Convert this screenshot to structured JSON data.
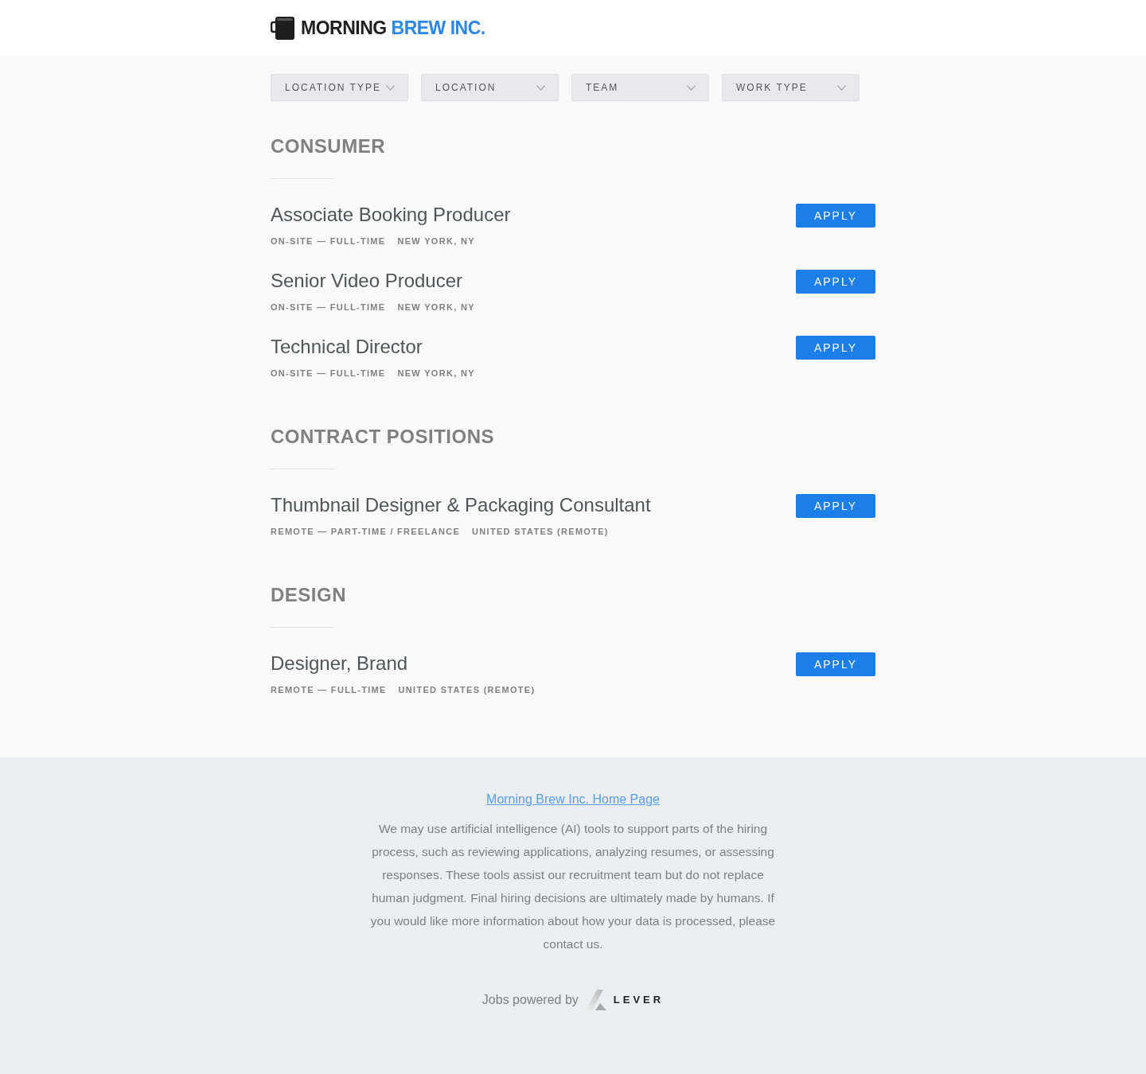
{
  "header": {
    "logo_text_dark": "MORNING",
    "logo_text_accent": "BREW INC."
  },
  "filters": [
    {
      "label": "LOCATION TYPE"
    },
    {
      "label": "LOCATION"
    },
    {
      "label": "TEAM"
    },
    {
      "label": "WORK TYPE"
    }
  ],
  "sections": [
    {
      "title": "CONSUMER",
      "postings": [
        {
          "title": "Associate Booking Producer",
          "commitment": "ON-SITE — FULL-TIME",
          "location": "NEW YORK, NY",
          "button": "APPLY"
        },
        {
          "title": "Senior Video Producer",
          "commitment": "ON-SITE — FULL-TIME",
          "location": "NEW YORK, NY",
          "button": "APPLY"
        },
        {
          "title": "Technical Director",
          "commitment": "ON-SITE — FULL-TIME",
          "location": "NEW YORK, NY",
          "button": "APPLY"
        }
      ]
    },
    {
      "title": "CONTRACT POSITIONS",
      "postings": [
        {
          "title": "Thumbnail Designer & Packaging Consultant",
          "commitment": "REMOTE — PART-TIME / FREELANCE",
          "location": "UNITED STATES (REMOTE)",
          "button": "APPLY"
        }
      ]
    },
    {
      "title": "DESIGN",
      "postings": [
        {
          "title": "Designer, Brand",
          "commitment": "REMOTE — FULL-TIME",
          "location": "UNITED STATES (REMOTE)",
          "button": "APPLY"
        }
      ]
    }
  ],
  "footer": {
    "link": "Morning Brew Inc. Home Page",
    "notice": "We may use artificial intelligence (AI) tools to support parts of the hiring process, such as reviewing applications, analyzing resumes, or assessing responses. These tools assist our recruitment team but do not replace human judgment. Final hiring decisions are ultimately made by humans. If you would like more information about how your data is processed, please contact us.",
    "powered_by": "Jobs powered by",
    "brand": "LEVER"
  }
}
